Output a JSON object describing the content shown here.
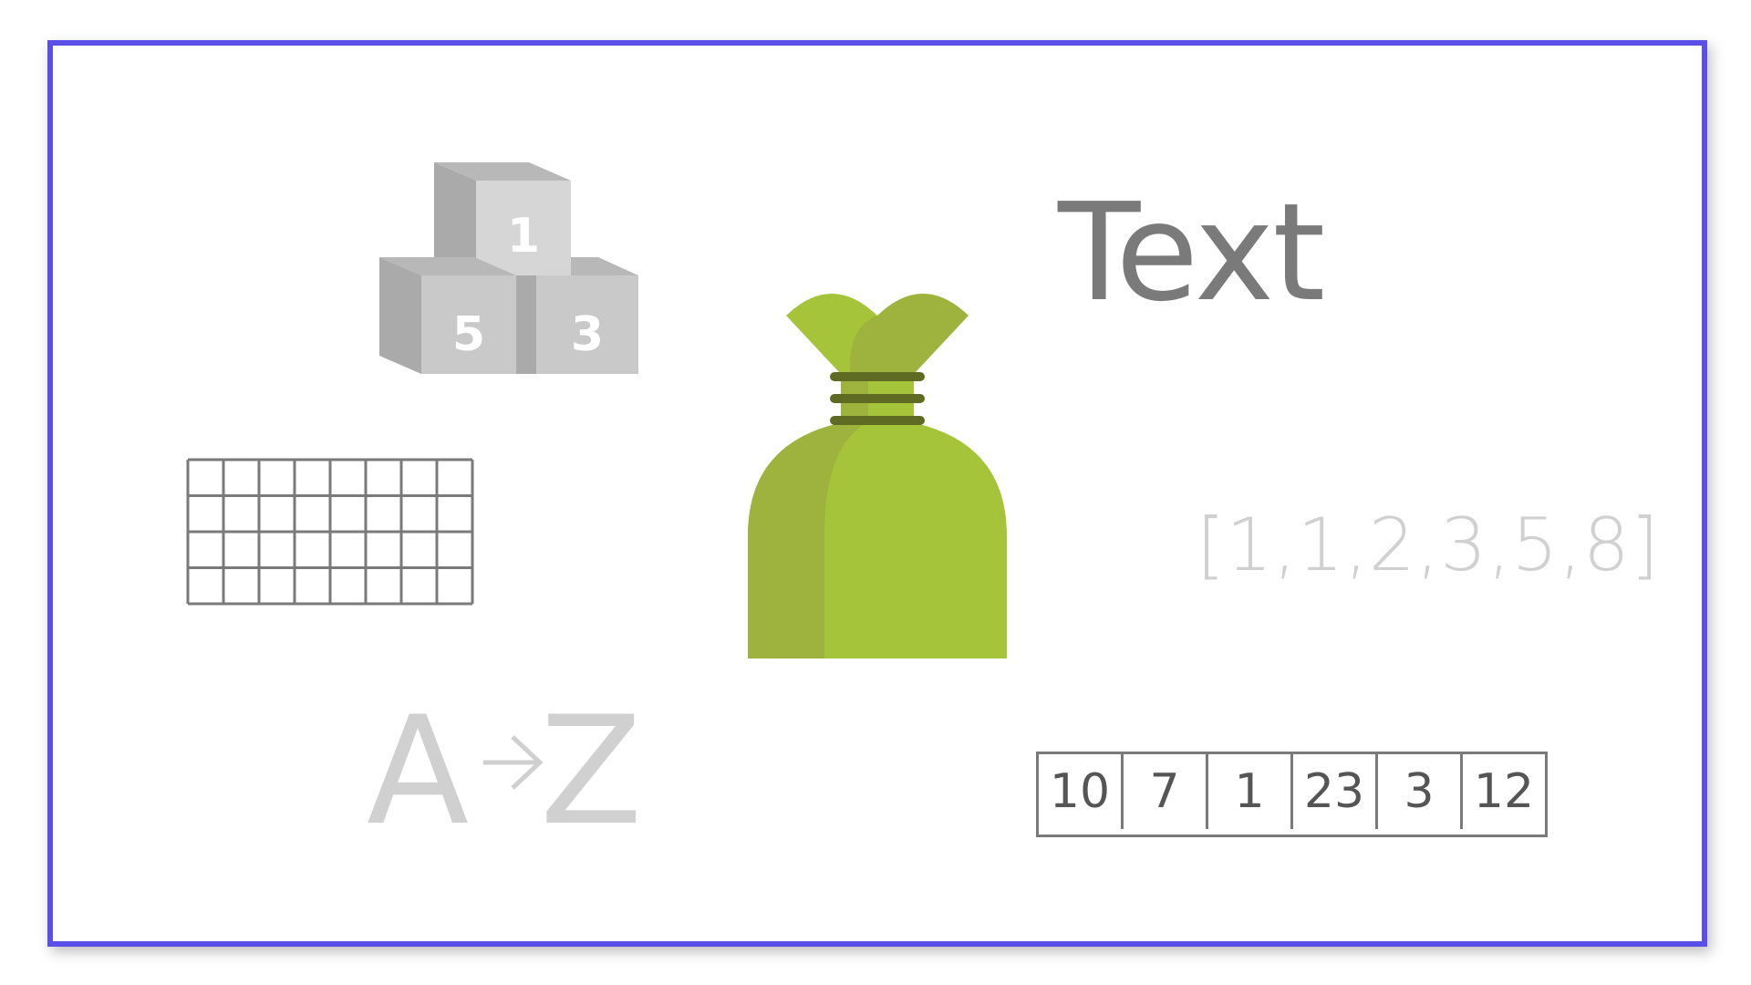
{
  "blocks": {
    "top": "1",
    "left": "5",
    "right": "3"
  },
  "text_label": "Text",
  "list_label": "[1,1,2,3,5,8]",
  "sort": {
    "from": "A",
    "to": "Z"
  },
  "array_cells": [
    "10",
    "7",
    "1",
    "23",
    "3",
    "12"
  ],
  "grid": {
    "rows": 4,
    "cols": 8
  },
  "colors": {
    "frame": "#5b50e6",
    "bag_light": "#a6c43a",
    "bag_dark": "#9db33e",
    "bag_tie": "#5f6b22",
    "block_face": "#c9c9c9",
    "block_side": "#aaaaaa",
    "text_gray": "#7a7a7a",
    "light_gray": "#d0d0d0"
  }
}
